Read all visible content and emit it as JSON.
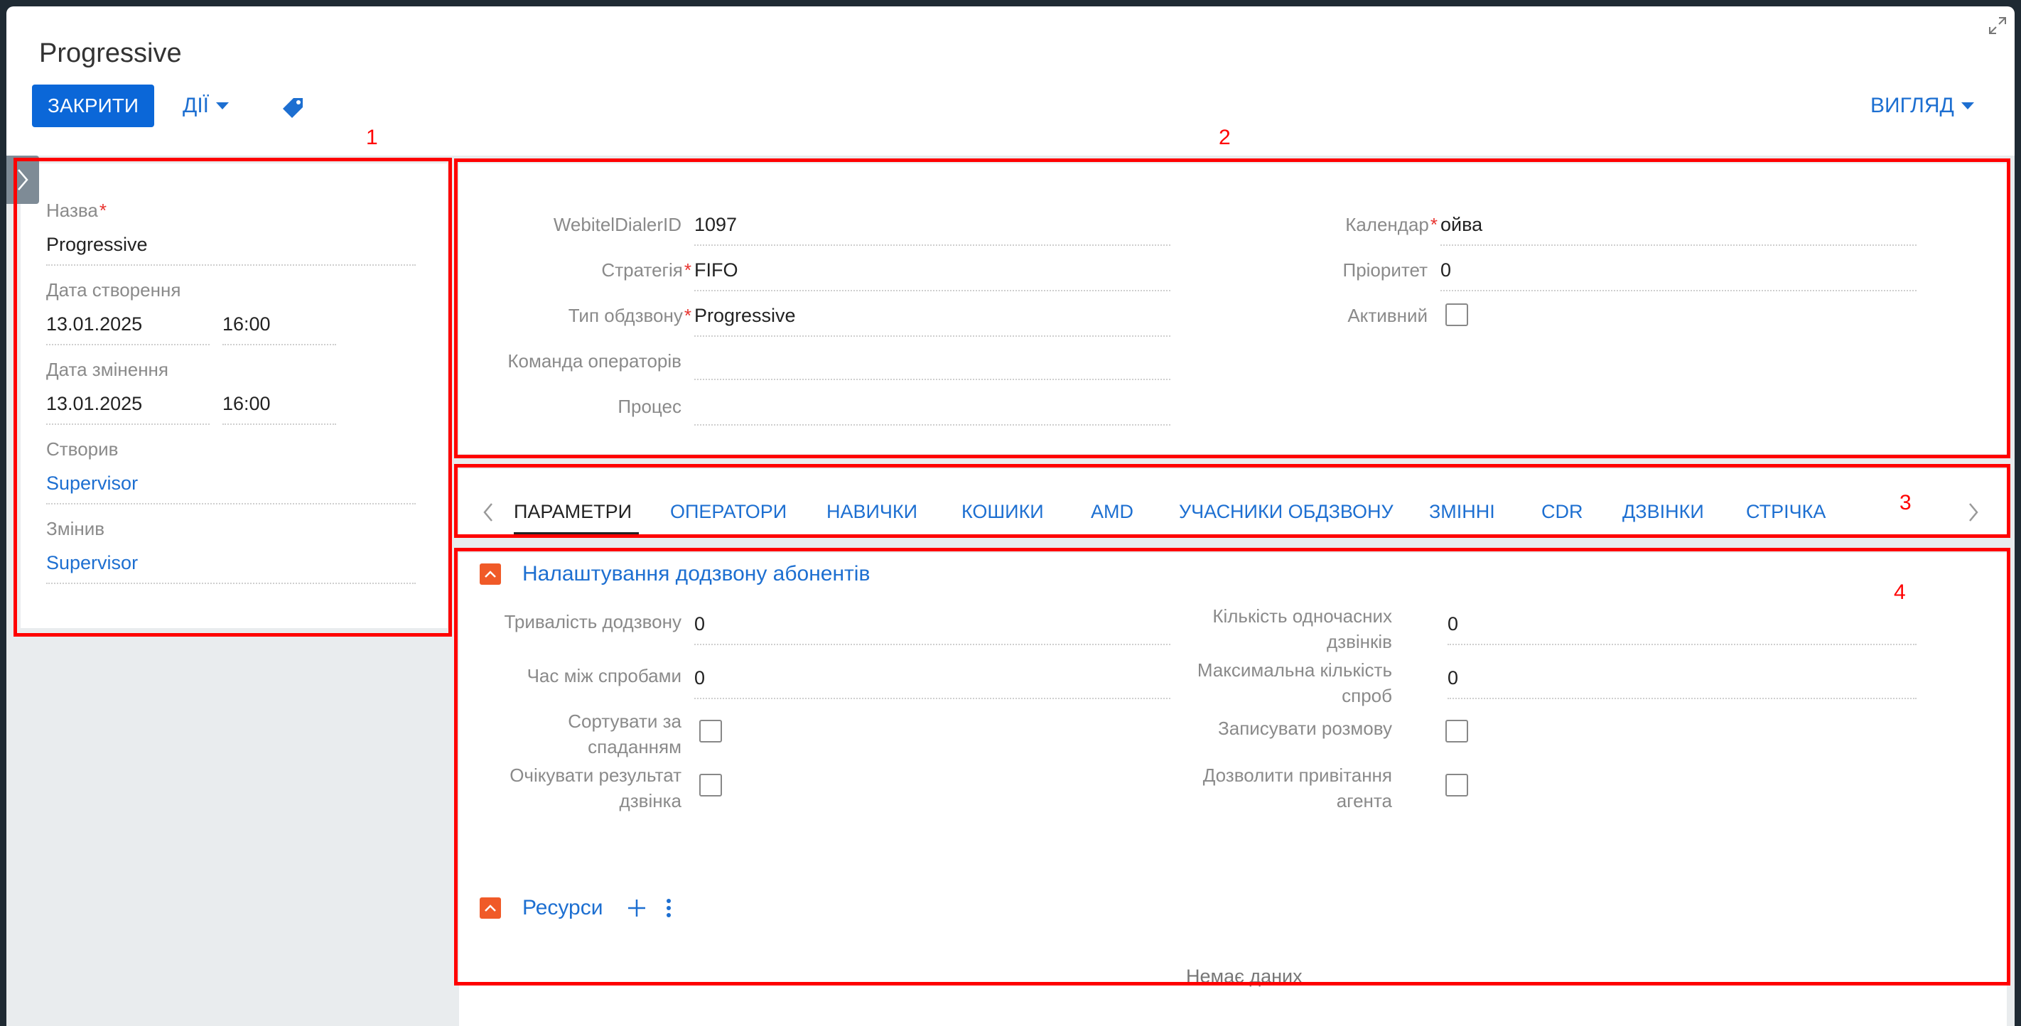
{
  "header": {
    "title": "Progressive",
    "close_label": "ЗАКРИТИ",
    "actions_label": "ДІЇ",
    "view_label": "ВИГЛЯД"
  },
  "annotations": [
    "1",
    "2",
    "3",
    "4"
  ],
  "left_panel": {
    "name_label": "Назва",
    "name_value": "Progressive",
    "created_label": "Дата створення",
    "created_date": "13.01.2025",
    "created_time": "16:00",
    "modified_label": "Дата змінення",
    "modified_date": "13.01.2025",
    "modified_time": "16:00",
    "created_by_label": "Створив",
    "created_by_value": "Supervisor",
    "modified_by_label": "Змінив",
    "modified_by_value": "Supervisor"
  },
  "main_fields": {
    "dialer_id_label": "WebitelDialerID",
    "dialer_id_value": "1097",
    "strategy_label": "Стратегія",
    "strategy_value": "FIFO",
    "dial_type_label": "Тип обдзвону",
    "dial_type_value": "Progressive",
    "team_label": "Команда операторів",
    "team_value": "",
    "process_label": "Процес",
    "process_value": "",
    "calendar_label": "Календар",
    "calendar_value": "ойва",
    "priority_label": "Пріоритет",
    "priority_value": "0",
    "active_label": "Активний"
  },
  "tabs": [
    {
      "label": "ПАРАМЕТРИ",
      "active": true
    },
    {
      "label": "ОПЕРАТОРИ"
    },
    {
      "label": "НАВИЧКИ"
    },
    {
      "label": "КОШИКИ"
    },
    {
      "label": "AMD"
    },
    {
      "label": "УЧАСНИКИ ОБДЗВОНУ"
    },
    {
      "label": "ЗМІННІ"
    },
    {
      "label": "CDR"
    },
    {
      "label": "ДЗВІНКИ"
    },
    {
      "label": "СТРІЧКА"
    }
  ],
  "settings": {
    "section_title": "Налаштування додзвону абонентів",
    "duration_label": "Тривалість додзвону",
    "duration_value": "0",
    "interval_label": "Час між спробами",
    "interval_value": "0",
    "sort_label_1": "Сортувати за",
    "sort_label_2": "спаданням",
    "wait_label_1": "Очікувати результат",
    "wait_label_2": "дзвінка",
    "concurrent_label_1": "Кількість одночасних",
    "concurrent_label_2": "дзвінків",
    "concurrent_value": "0",
    "max_attempts_label_1": "Максимальна кількість",
    "max_attempts_label_2": "спроб",
    "max_attempts_value": "0",
    "record_label": "Записувати розмову",
    "greeting_label_1": "Дозволити привітання",
    "greeting_label_2": "агента"
  },
  "resources": {
    "section_title": "Ресурси",
    "empty_text": "Немає даних"
  },
  "colors": {
    "primary": "#0b67d8",
    "link": "#1d6fd1",
    "required": "#e8332e",
    "section_toggle": "#f05a28",
    "annotation": "#ff0000"
  }
}
